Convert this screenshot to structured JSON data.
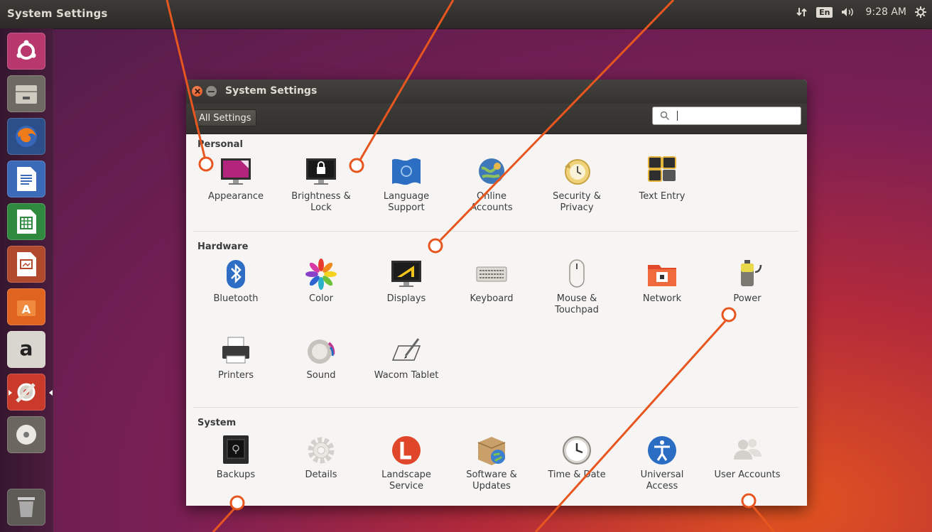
{
  "top_panel": {
    "app_title": "System Settings",
    "keyboard_layout": "En",
    "clock": "9:28 AM",
    "icons": [
      "network-icon",
      "keyboard-layout-indicator",
      "volume-icon",
      "session-gear-icon"
    ]
  },
  "launcher": {
    "items": [
      {
        "name": "ubuntu-dash-icon"
      },
      {
        "name": "files-icon"
      },
      {
        "name": "firefox-icon"
      },
      {
        "name": "libreoffice-writer-icon"
      },
      {
        "name": "libreoffice-calc-icon"
      },
      {
        "name": "libreoffice-impress-icon"
      },
      {
        "name": "ubuntu-software-icon"
      },
      {
        "name": "amazon-icon",
        "glyph": "a"
      },
      {
        "name": "system-settings-icon"
      },
      {
        "name": "dvd-icon"
      },
      {
        "name": "trash-icon"
      }
    ]
  },
  "window": {
    "title": "System Settings",
    "all_settings_label": "All Settings",
    "search": {
      "placeholder": "",
      "value": ""
    }
  },
  "sections": [
    {
      "title": "Personal",
      "items": [
        {
          "label": "Appearance",
          "icon": "appearance-icon"
        },
        {
          "label": "Brightness &\nLock",
          "icon": "brightness-lock-icon"
        },
        {
          "label": "Language\nSupport",
          "icon": "language-support-icon"
        },
        {
          "label": "Online\nAccounts",
          "icon": "online-accounts-icon"
        },
        {
          "label": "Security &\nPrivacy",
          "icon": "security-privacy-icon"
        },
        {
          "label": "Text Entry",
          "icon": "text-entry-icon"
        }
      ]
    },
    {
      "title": "Hardware",
      "items": [
        {
          "label": "Bluetooth",
          "icon": "bluetooth-icon"
        },
        {
          "label": "Color",
          "icon": "color-icon"
        },
        {
          "label": "Displays",
          "icon": "displays-icon"
        },
        {
          "label": "Keyboard",
          "icon": "keyboard-icon"
        },
        {
          "label": "Mouse &\nTouchpad",
          "icon": "mouse-touchpad-icon"
        },
        {
          "label": "Network",
          "icon": "network-settings-icon"
        },
        {
          "label": "Power",
          "icon": "power-icon"
        },
        {
          "label": "Printers",
          "icon": "printers-icon"
        },
        {
          "label": "Sound",
          "icon": "sound-icon"
        },
        {
          "label": "Wacom Tablet",
          "icon": "wacom-tablet-icon"
        }
      ]
    },
    {
      "title": "System",
      "items": [
        {
          "label": "Backups",
          "icon": "backups-icon"
        },
        {
          "label": "Details",
          "icon": "details-icon"
        },
        {
          "label": "Landscape\nService",
          "icon": "landscape-service-icon"
        },
        {
          "label": "Software &\nUpdates",
          "icon": "software-updates-icon"
        },
        {
          "label": "Time & Date",
          "icon": "time-date-icon"
        },
        {
          "label": "Universal\nAccess",
          "icon": "universal-access-icon"
        },
        {
          "label": "User Accounts",
          "icon": "user-accounts-icon"
        }
      ]
    }
  ],
  "colors": {
    "annotation": "#e8561f",
    "panel": "#2b2a27",
    "window_bg": "#f6f5f4"
  }
}
